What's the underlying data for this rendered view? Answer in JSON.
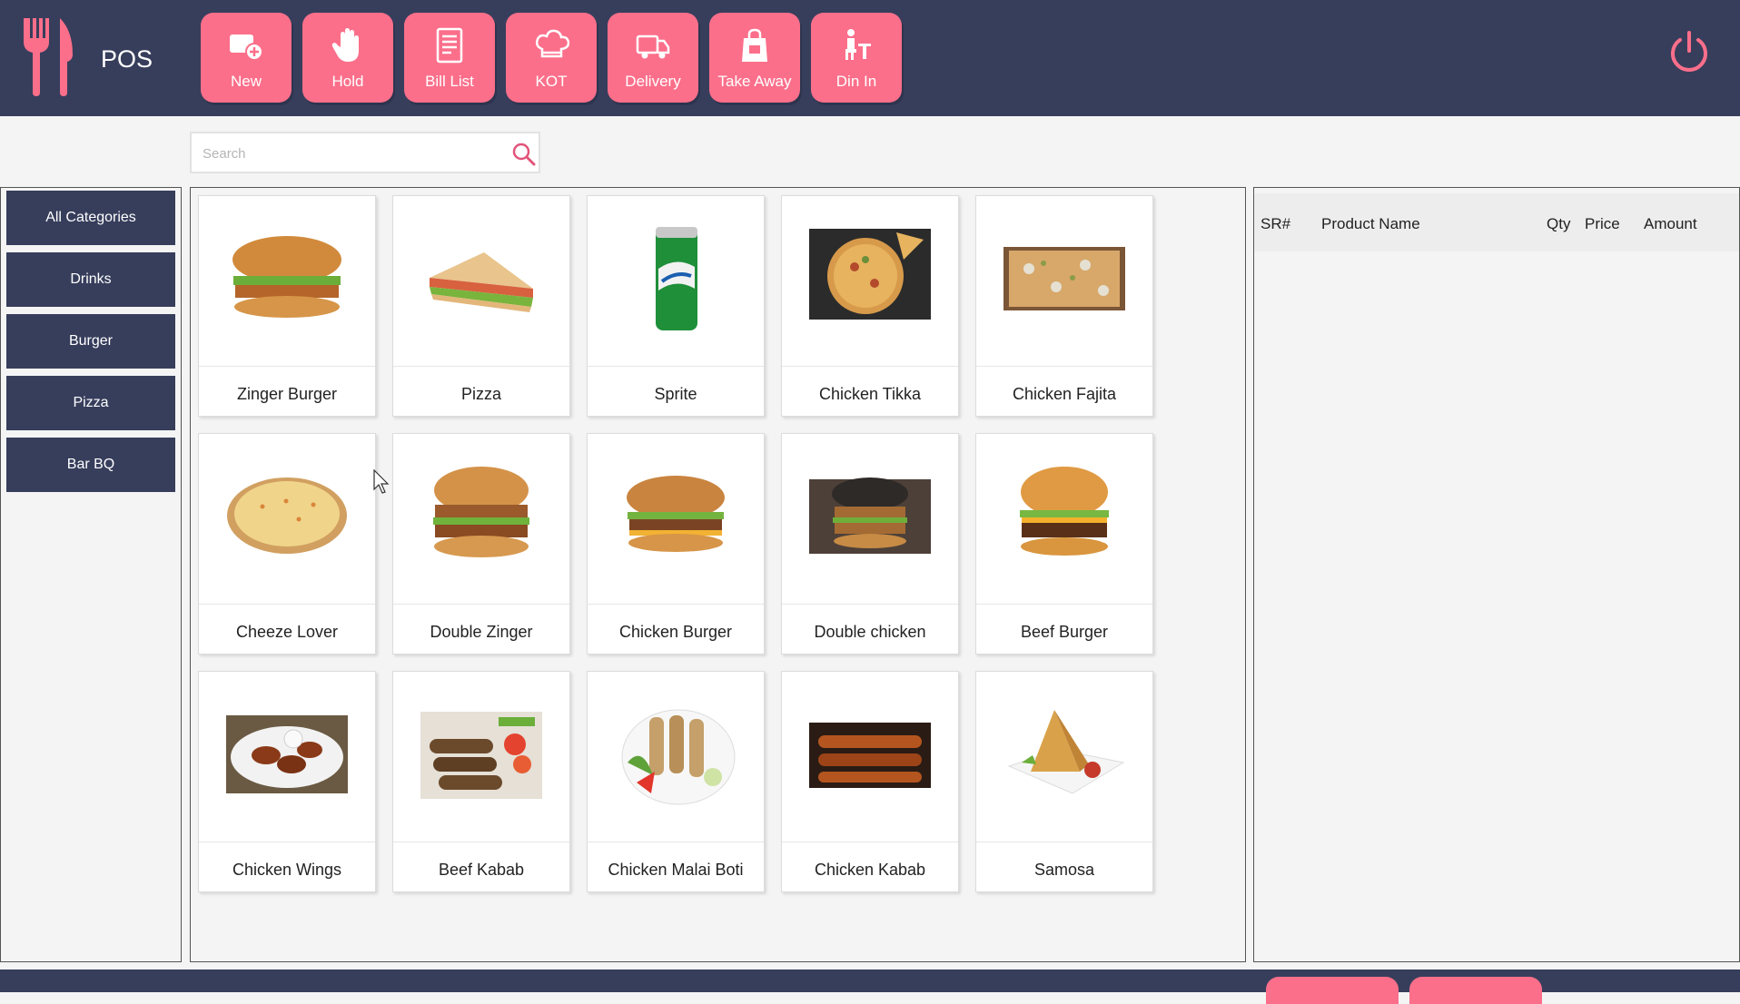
{
  "app": {
    "title": "POS"
  },
  "toolbar": {
    "buttons": [
      {
        "label": "New",
        "icon": "new-order-icon"
      },
      {
        "label": "Hold",
        "icon": "hand-icon"
      },
      {
        "label": "Bill List",
        "icon": "bill-list-icon"
      },
      {
        "label": "KOT",
        "icon": "chef-hat-icon"
      },
      {
        "label": "Delivery",
        "icon": "delivery-truck-icon"
      },
      {
        "label": "Take Away",
        "icon": "takeaway-bag-icon"
      },
      {
        "label": "Din In",
        "icon": "dine-in-icon"
      }
    ]
  },
  "search": {
    "placeholder": "Search",
    "value": ""
  },
  "categories": [
    "All Categories",
    "Drinks",
    "Burger",
    "Pizza",
    "Bar BQ"
  ],
  "products": [
    {
      "name": "Zinger Burger",
      "image": "burger"
    },
    {
      "name": "Pizza",
      "image": "sandwich"
    },
    {
      "name": "Sprite",
      "image": "soda-can"
    },
    {
      "name": "Chicken Tikka",
      "image": "pizza"
    },
    {
      "name": "Chicken Fajita",
      "image": "pizza"
    },
    {
      "name": "Cheeze Lover",
      "image": "pizza"
    },
    {
      "name": "Double Zinger",
      "image": "burger"
    },
    {
      "name": "Chicken Burger",
      "image": "burger"
    },
    {
      "name": "Double chicken",
      "image": "burger"
    },
    {
      "name": "Beef Burger",
      "image": "burger"
    },
    {
      "name": "Chicken Wings",
      "image": "wings"
    },
    {
      "name": "Beef Kabab",
      "image": "kabab"
    },
    {
      "name": "Chicken Malai Boti",
      "image": "skewers"
    },
    {
      "name": "Chicken Kabab",
      "image": "kabab"
    },
    {
      "name": "Samosa",
      "image": "samosa"
    }
  ],
  "order": {
    "columns": [
      "SR#",
      "Product Name",
      "Qty",
      "Price",
      "Amount"
    ],
    "rows": []
  },
  "colors": {
    "navy": "#373e5c",
    "accent": "#fb6f8a"
  }
}
